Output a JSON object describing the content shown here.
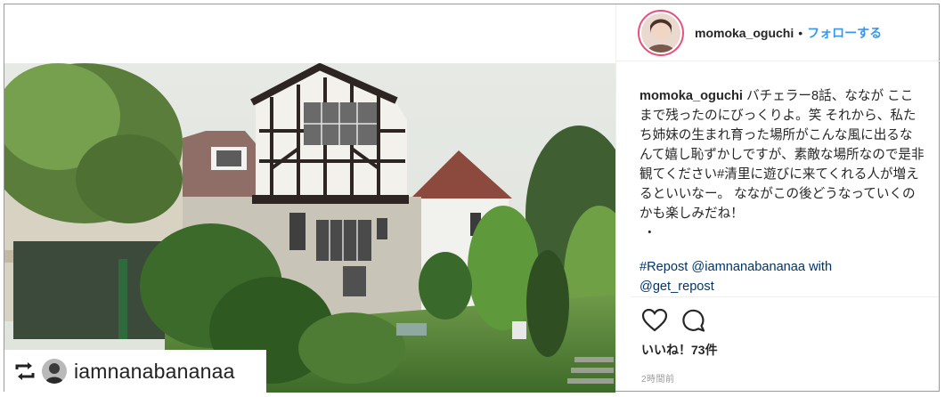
{
  "post": {
    "author": {
      "username": "momoka_oguchi",
      "separator": "•",
      "follow_label": "フォローする"
    },
    "caption": {
      "username": "momoka_oguchi",
      "text": " バチェラー8話、ななが ここまで残ったのにびっくりよ。笑 それから、私たち姉妹の生まれ育った場所がこんな風に出るなんて嬉し恥ずかしですが、素敵な場所なので是非観てください#清里に遊びに来てくれる人が増えるといいなー。 なながこの後どうなっていくのかも楽しみだね！",
      "bullet": "・"
    },
    "hashtags": {
      "repost_tag": "#Repost",
      "mention_1": "@iamnanabananaa",
      "with_word": " with",
      "mention_2": "@get_repost"
    },
    "repost_badge": {
      "username": "iamnanabananaa"
    },
    "likes_text": "いいね！73件",
    "time_text": "2時間前",
    "icons": {
      "like": "heart-outline-icon",
      "comment": "comment-bubble-icon",
      "repost": "repost-arrows-icon"
    },
    "colors": {
      "follow": "#3897f0",
      "hashtag": "#003569",
      "ring": "#e94f7a"
    }
  }
}
